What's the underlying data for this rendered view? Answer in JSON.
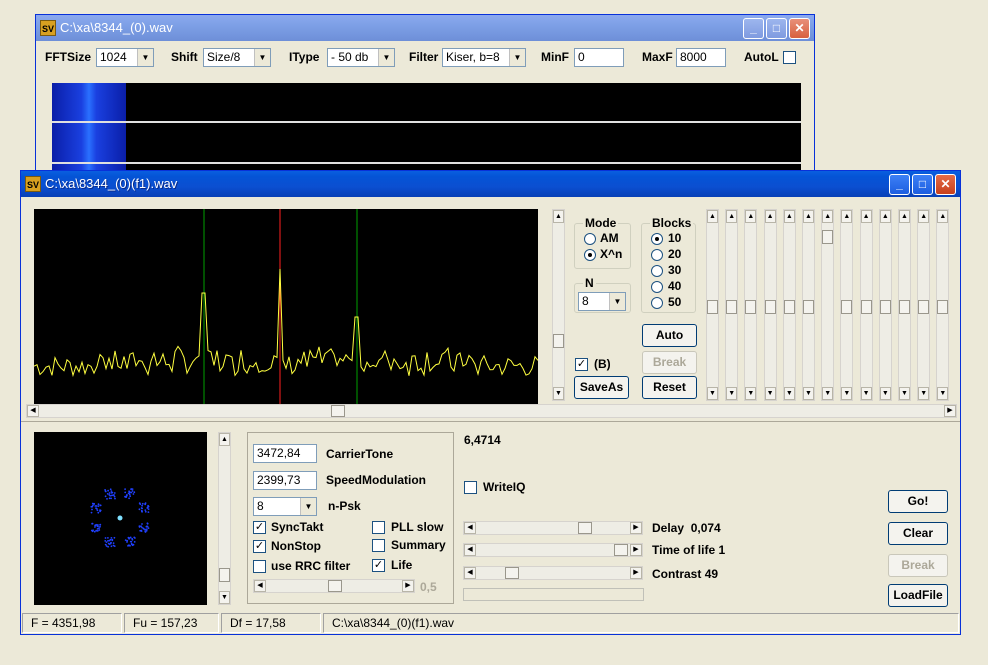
{
  "back_window": {
    "title": "C:\\xa\\8344_(0).wav",
    "toolbar": {
      "fftsize_label": "FFTSize",
      "fftsize_value": "1024",
      "shift_label": "Shift",
      "shift_value": "Size/8",
      "itype_label": "IType",
      "itype_value": "- 50 db",
      "filter_label": "Filter",
      "filter_value": "Kiser, b=8",
      "minf_label": "MinF",
      "minf_value": "0",
      "maxf_label": "MaxF",
      "maxf_value": "8000",
      "autol_label": "AutoL"
    }
  },
  "front_window": {
    "title": "C:\\xa\\8344_(0)(f1).wav",
    "mode_group": {
      "label": "Mode",
      "options": [
        "AM",
        "X^n"
      ],
      "selected": "X^n"
    },
    "blocks_group": {
      "label": "Blocks",
      "options": [
        "10",
        "20",
        "30",
        "40",
        "50"
      ],
      "selected": "10"
    },
    "n_group": {
      "label": "N",
      "value": "8"
    },
    "b_checkbox": {
      "label": "(B)",
      "checked": true
    },
    "buttons": {
      "auto": "Auto",
      "break": "Break",
      "reset": "Reset",
      "saveas": "SaveAs"
    },
    "readout": "6,4714",
    "carrier_tone": {
      "value": "3472,84",
      "label": "CarrierTone"
    },
    "speed_modulation": {
      "value": "2399,73",
      "label": "SpeedModulation"
    },
    "npsk": {
      "value": "8",
      "label": "n-Psk"
    },
    "checks": {
      "sync_takt": {
        "label": "SyncTakt",
        "checked": true
      },
      "pll_slow": {
        "label": "PLL slow",
        "checked": false
      },
      "non_stop": {
        "label": "NonStop",
        "checked": true
      },
      "summary": {
        "label": "Summary",
        "checked": false
      },
      "rrc": {
        "label": "use RRC filter",
        "checked": false
      },
      "life": {
        "label": "Life",
        "checked": true
      }
    },
    "slider_value": "0,5",
    "writeiq": {
      "label": "WriteIQ",
      "checked": false
    },
    "delay": {
      "label": "Delay",
      "value": "0,074"
    },
    "time_of_life": {
      "label": "Time of life",
      "value": "1"
    },
    "contrast": {
      "label": "Contrast",
      "value": "49"
    },
    "right_buttons": {
      "go": "Go!",
      "clear": "Clear",
      "break": "Break",
      "loadfile": "LoadFile"
    },
    "status": {
      "f": "F = 4351,98",
      "fu": "Fu = 157,23",
      "df": "Df = 17,58",
      "file": "C:\\xa\\8344_(0)(f1).wav"
    }
  },
  "colors": {
    "spectrum_line": "#ffff40",
    "marker_green": "#00a000",
    "marker_red": "#ff2020",
    "constellation": "#2040ff"
  }
}
